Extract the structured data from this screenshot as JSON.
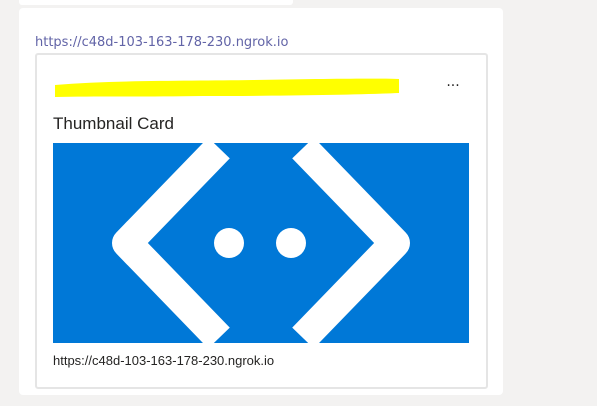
{
  "message": {
    "link_text": "https://c48d-103-163-178-230.ngrok.io"
  },
  "card": {
    "title": "Thumbnail Card",
    "more_options_label": "···",
    "image_icon": "bot-framework-logo-icon",
    "footer_url": "https://c48d-103-163-178-230.ngrok.io",
    "image_background_color": "#0078d7",
    "redaction_color": "#ffff00"
  }
}
